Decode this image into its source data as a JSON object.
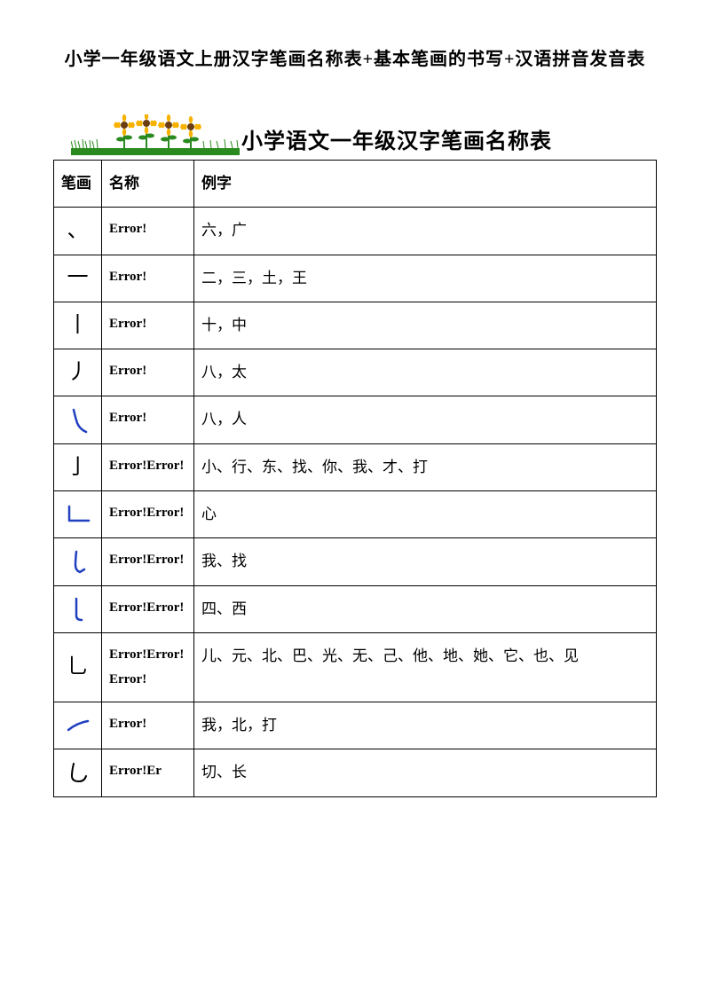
{
  "page_title": "小学一年级语文上册汉字笔画名称表+基本笔画的书写+汉语拼音发音表",
  "section_title": "小学语文一年级汉字笔画名称表",
  "headers": {
    "stroke": "笔画",
    "name": "名称",
    "example": "例字"
  },
  "rows": [
    {
      "stroke": "、",
      "stroke_blue": false,
      "name": "Error!",
      "example": "六，广"
    },
    {
      "stroke": "一",
      "stroke_blue": false,
      "name": "Error!",
      "example": "二，三，土，王"
    },
    {
      "stroke": "丨",
      "stroke_blue": false,
      "name": "Error!",
      "example": "十，中"
    },
    {
      "stroke": "丿",
      "stroke_blue": false,
      "name": "Error!",
      "example": "八，太"
    },
    {
      "stroke": "svg1",
      "stroke_blue": true,
      "name": "Error!",
      "example": "八，人"
    },
    {
      "stroke": "亅",
      "stroke_blue": false,
      "name": "Error!Error!",
      "example": "小、行、东、找、你、我、才、打"
    },
    {
      "stroke": "svg2",
      "stroke_blue": true,
      "name": "Error!Error!",
      "example": "心"
    },
    {
      "stroke": "svg3",
      "stroke_blue": true,
      "name": "Error!Error!",
      "example": "我、找"
    },
    {
      "stroke": "svg4",
      "stroke_blue": true,
      "name": "Error!Error!",
      "example": "四、西"
    },
    {
      "stroke": "乚",
      "stroke_blue": false,
      "name": "Error!Error!Error!",
      "example": "儿、元、北、巴、光、无、己、他、地、她、它、也、见"
    },
    {
      "stroke": "svg5",
      "stroke_blue": true,
      "name": "Error!",
      "example": "我，北，打"
    },
    {
      "stroke": "svg6",
      "stroke_blue": false,
      "name": "Error!Er",
      "example": "切、长"
    }
  ],
  "svg_strokes": {
    "svg1": "<svg class='svg-stroke' width='26' height='30' viewBox='0 0 26 30'><path d='M8 3 Q10 12 12 18 Q15 25 22 28' stroke='#2040c0' stroke-width='2.5' fill='none' stroke-linecap='round'/></svg>",
    "svg2": "<svg class='svg-stroke' width='32' height='26' viewBox='0 0 32 26'><path d='M6 4 L6 20 L28 20' stroke='#2040c0' stroke-width='2.5' fill='none' stroke-linecap='round' stroke-linejoin='round'/></svg>",
    "svg3": "<svg class='svg-stroke' width='24' height='30' viewBox='0 0 24 30'><path d='M10 3 Q9 12 9 18 Q9 24 14 26 L19 23' stroke='#2040c0' stroke-width='2.5' fill='none' stroke-linecap='round'/></svg>",
    "svg4": "<svg class='svg-stroke' width='24' height='30' viewBox='0 0 24 30'><path d='M10 3 L10 22 Q10 27 16 27' stroke='#2040c0' stroke-width='2.5' fill='none' stroke-linecap='round'/></svg>",
    "svg5": "<svg class='svg-stroke' width='30' height='18' viewBox='0 0 30 18'><path d='M4 14 Q14 6 26 4' stroke='#2040c0' stroke-width='2.5' fill='none' stroke-linecap='round'/></svg>",
    "svg6": "<svg class='svg-stroke' width='26' height='28' viewBox='0 0 26 28'><path d='M8 4 Q6 12 6 18 Q6 24 14 24 Q20 24 22 18' stroke='#000' stroke-width='2' fill='none' stroke-linecap='round'/></svg>"
  }
}
